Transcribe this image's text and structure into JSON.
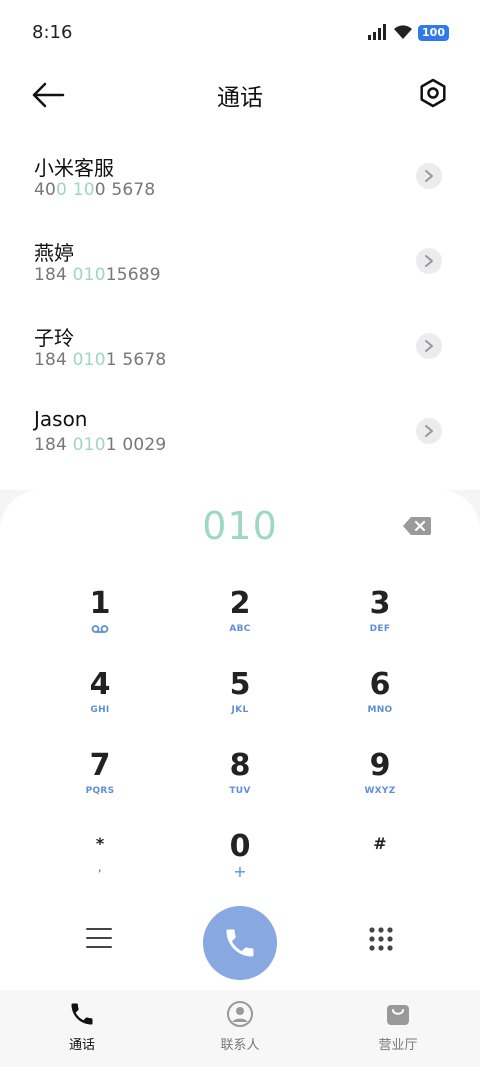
{
  "status_bar": {
    "time": "8:16",
    "battery": "100"
  },
  "header": {
    "title": "通话"
  },
  "contacts": [
    {
      "name": "小米客服",
      "number_parts": [
        "40",
        "0",
        " ",
        "10",
        "0 5678"
      ]
    },
    {
      "name": "燕婷",
      "number_parts": [
        "184 ",
        "010",
        "",
        "",
        "15689"
      ]
    },
    {
      "name": "子玲",
      "number_parts": [
        "184 ",
        "010",
        "",
        "",
        "1 5678"
      ]
    },
    {
      "name": "Jason",
      "number_parts": [
        "184 ",
        "010",
        "",
        "",
        "1 0029"
      ]
    }
  ],
  "dialer": {
    "input": "010",
    "keys": [
      {
        "digit": "1",
        "letters": ""
      },
      {
        "digit": "2",
        "letters": "ABC"
      },
      {
        "digit": "3",
        "letters": "DEF"
      },
      {
        "digit": "4",
        "letters": "GHI"
      },
      {
        "digit": "5",
        "letters": "JKL"
      },
      {
        "digit": "6",
        "letters": "MNO"
      },
      {
        "digit": "7",
        "letters": "PQRS"
      },
      {
        "digit": "8",
        "letters": "TUV"
      },
      {
        "digit": "9",
        "letters": "WXYZ"
      },
      {
        "digit": "*",
        "letters": ","
      },
      {
        "digit": "0",
        "letters": "+"
      },
      {
        "digit": "#",
        "letters": ""
      }
    ]
  },
  "tabs": [
    {
      "label": "通话",
      "icon": "phone-icon",
      "active": true
    },
    {
      "label": "联系人",
      "icon": "contact-icon",
      "active": false
    },
    {
      "label": "营业厅",
      "icon": "shop-bag-icon",
      "active": false
    }
  ],
  "colors": {
    "accent_call": "#87a8e0",
    "highlight_digits": "#9fd8c2",
    "letters": "#5f8fd6"
  }
}
